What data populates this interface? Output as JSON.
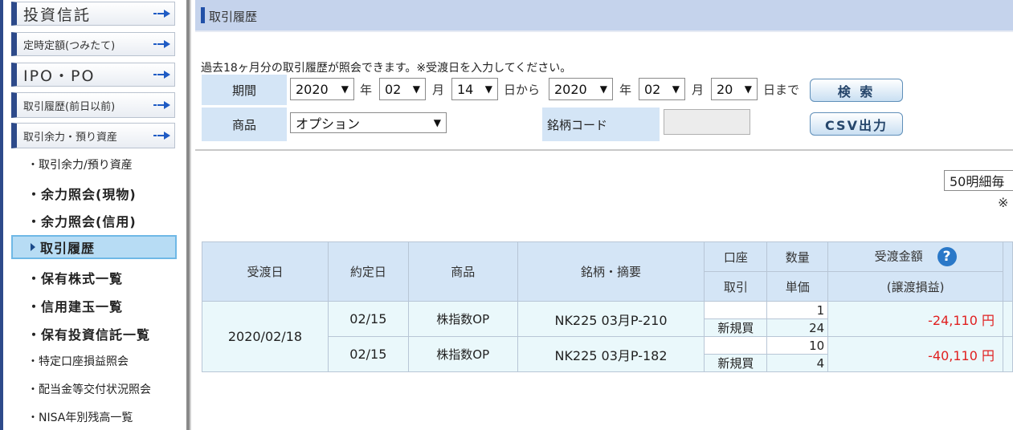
{
  "sidebar": {
    "menus": [
      {
        "label": "投資信託",
        "size": "big"
      },
      {
        "label": "定時定額(つみたて)",
        "size": "small"
      },
      {
        "label": "IPO・PO",
        "size": "big"
      },
      {
        "label": "取引履歴(前日以前)",
        "size": "small"
      },
      {
        "label": "取引余力・預り資産",
        "size": "small"
      }
    ],
    "subitems": [
      {
        "label": "・取引余力/預り資産",
        "style": "small"
      },
      {
        "label": "・余力照会(現物)",
        "style": "bold"
      },
      {
        "label": "・余力照会(信用)",
        "style": "bold"
      },
      {
        "label": "取引履歴",
        "style": "active"
      },
      {
        "label": "・保有株式一覧",
        "style": "bold"
      },
      {
        "label": "・信用建玉一覧",
        "style": "bold"
      },
      {
        "label": "・保有投資信託一覧",
        "style": "bold"
      },
      {
        "label": "・特定口座損益照会",
        "style": "small"
      },
      {
        "label": "・配当金等交付状況照会",
        "style": "small"
      },
      {
        "label": "・NISA年別残高一覧",
        "style": "small"
      }
    ]
  },
  "header": {
    "title": "取引履歴"
  },
  "info_text": "過去18ヶ月分の取引履歴が照会できます。※受渡日を入力してください。",
  "search": {
    "period_label": "期間",
    "from": {
      "year": "2020",
      "month": "02",
      "day": "14"
    },
    "to": {
      "year": "2020",
      "month": "02",
      "day": "20"
    },
    "unit_year": "年",
    "unit_month": "月",
    "unit_from": "日から",
    "unit_to": "日まで",
    "search_button": "検 索",
    "product_label": "商品",
    "product_value": "オプション",
    "code_label": "銘柄コード",
    "code_value": "",
    "csv_button": "CSV出力",
    "per_page": "50明細毎",
    "note_mark": "※",
    "caret": "▼"
  },
  "table": {
    "headers": {
      "settle_date": "受渡日",
      "trade_date": "約定日",
      "product": "商品",
      "issue": "銘柄・摘要",
      "account": "口座",
      "trade": "取引",
      "quantity": "数量",
      "unit_price": "単価",
      "amount": "受渡金額",
      "amount_sub": "(譲渡損益)",
      "help": "?"
    },
    "settle_date_value": "2020/02/18",
    "rows": [
      {
        "trade_date": "02/15",
        "product": "株指数OP",
        "issue": "NK225 03月P-210",
        "account": "",
        "trade": "新規買",
        "quantity": "1",
        "unit_price": "24",
        "amount": "-24,110 円"
      },
      {
        "trade_date": "02/15",
        "product": "株指数OP",
        "issue": "NK225 03月P-182",
        "account": "",
        "trade": "新規買",
        "quantity": "10",
        "unit_price": "4",
        "amount": "-40,110 円"
      }
    ]
  },
  "colors": {
    "accent": "#2d4a8a",
    "header_bg": "#c5d3ec",
    "cell_bg": "#d4e5f6",
    "negative": "#e02020"
  }
}
